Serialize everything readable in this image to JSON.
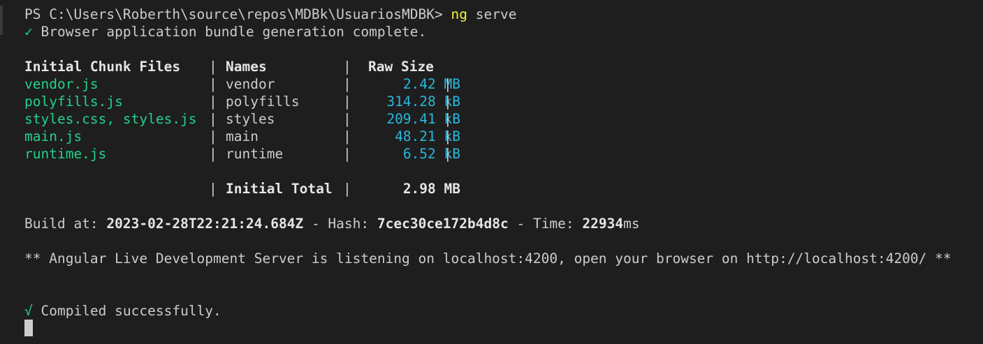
{
  "terminal": {
    "prompt": "PS C:\\Users\\Roberth\\source\\repos\\MDBk\\UsuariosMDBK>",
    "command_name": "ng",
    "command_args": "serve",
    "bundle_check": "✓",
    "bundle_status": "Browser application bundle generation complete.",
    "table": {
      "headers": [
        "Initial Chunk Files",
        "Names",
        "Raw Size"
      ],
      "rows": [
        {
          "file": "vendor.js",
          "name": "vendor",
          "size": "2.42 MB"
        },
        {
          "file": "polyfills.js",
          "name": "polyfills",
          "size": "314.28 kB"
        },
        {
          "file": "styles.css, styles.js",
          "name": "styles",
          "size": "209.41 kB"
        },
        {
          "file": "main.js",
          "name": "main",
          "size": "48.21 kB"
        },
        {
          "file": "runtime.js",
          "name": "runtime",
          "size": "6.52 kB"
        }
      ],
      "total_label": "Initial Total",
      "total_value": "2.98 MB"
    },
    "build": {
      "build_at_label": "Build at:",
      "build_at_value": "2023-02-28T22:21:24.684Z",
      "hash_label": "- Hash:",
      "hash_value": "7cec30ce172b4d8c",
      "time_label": "- Time:",
      "time_value": "22934",
      "time_unit": "ms"
    },
    "server_message": "** Angular Live Development Server is listening on localhost:4200, open your browser on http://localhost:4200/ **",
    "compiled_check": "√",
    "compiled_status": "Compiled successfully.",
    "colors": {
      "background": "#1e1e1e",
      "text": "#cccccc",
      "file_green": "#23d18b",
      "size_cyan": "#29b8db",
      "command_yellow": "#f5f543"
    }
  }
}
